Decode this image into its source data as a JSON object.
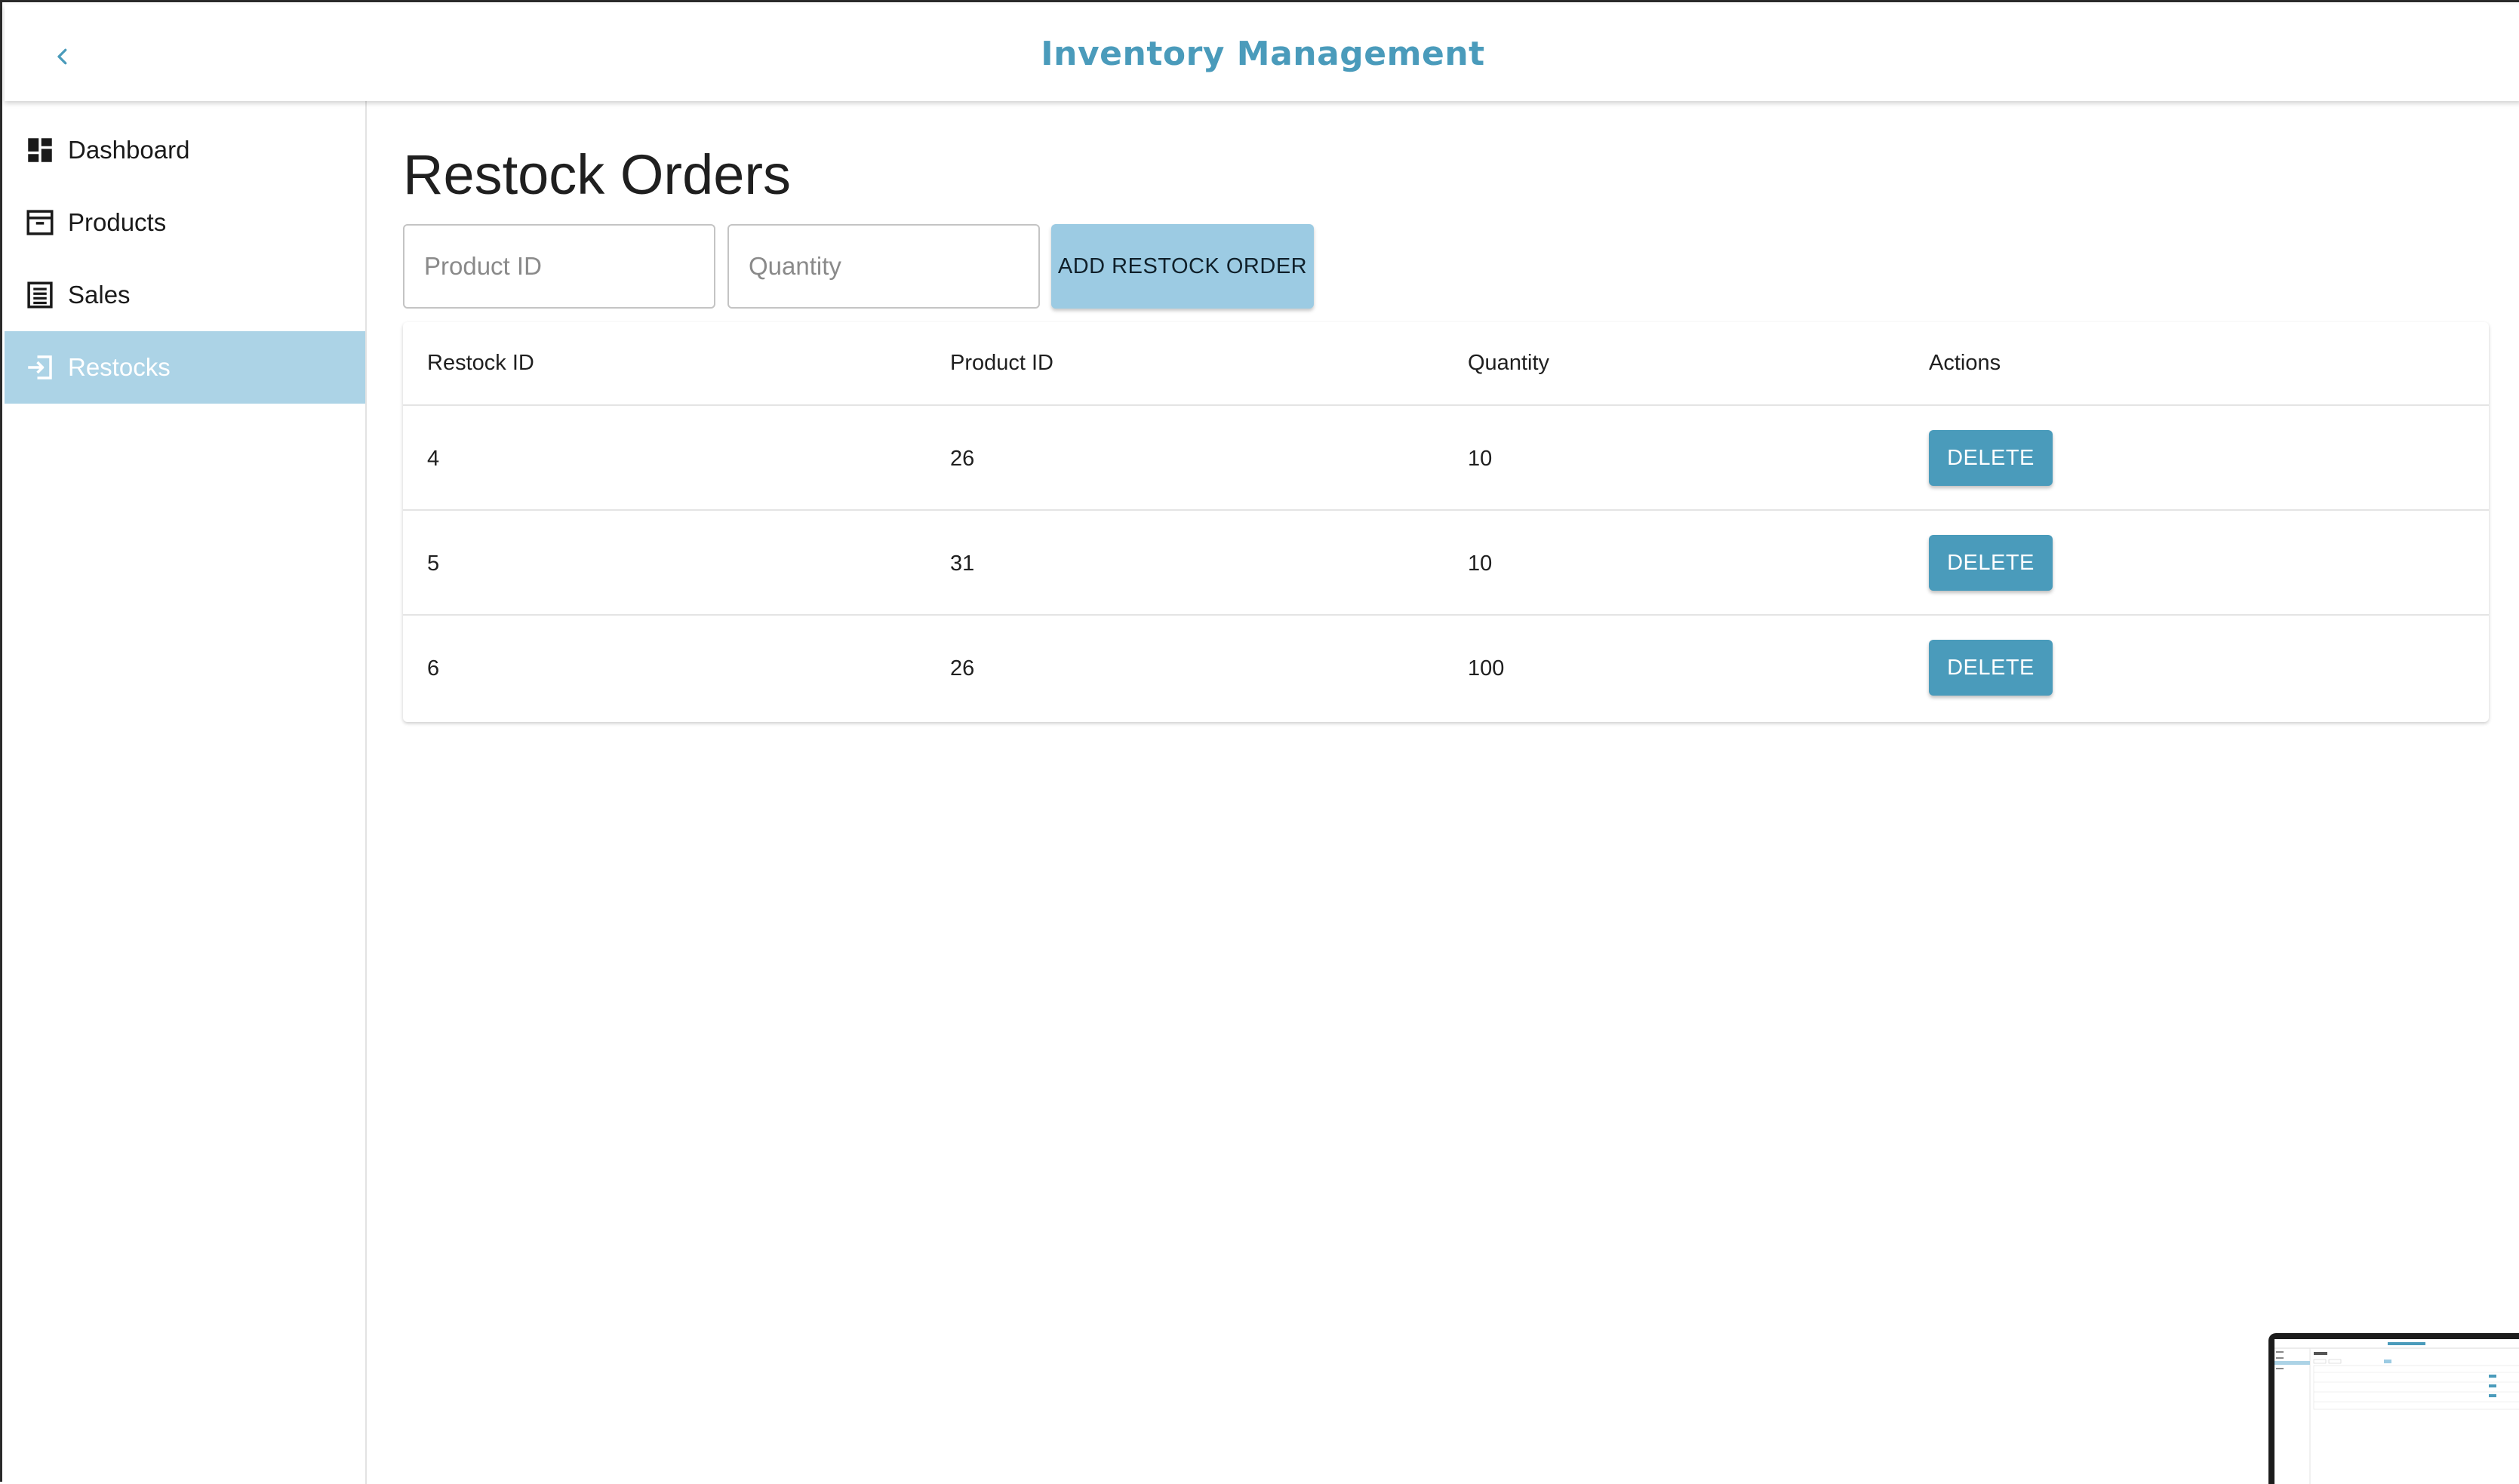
{
  "app": {
    "title": "Inventory Management",
    "accent_color": "#4a9bbb",
    "active_nav_color": "#acd3e6"
  },
  "appbar": {
    "back_icon": "chevron-left-icon"
  },
  "sidebar": {
    "items": [
      {
        "label": "Dashboard",
        "icon": "dashboard-icon",
        "active": false
      },
      {
        "label": "Products",
        "icon": "archive-box-icon",
        "active": false
      },
      {
        "label": "Sales",
        "icon": "receipt-icon",
        "active": false
      },
      {
        "label": "Restocks",
        "icon": "login-arrow-icon",
        "active": true
      }
    ]
  },
  "main": {
    "title": "Restock Orders",
    "form": {
      "product_id_placeholder": "Product ID",
      "product_id_value": "",
      "quantity_placeholder": "Quantity",
      "quantity_value": "",
      "add_button_label": "ADD RESTOCK ORDER"
    },
    "table": {
      "headers": [
        "Restock ID",
        "Product ID",
        "Quantity",
        "Actions"
      ],
      "rows": [
        {
          "restock_id": "4",
          "product_id": "26",
          "quantity": "10",
          "action_label": "DELETE"
        },
        {
          "restock_id": "5",
          "product_id": "31",
          "quantity": "10",
          "action_label": "DELETE"
        },
        {
          "restock_id": "6",
          "product_id": "26",
          "quantity": "100",
          "action_label": "DELETE"
        }
      ]
    }
  }
}
